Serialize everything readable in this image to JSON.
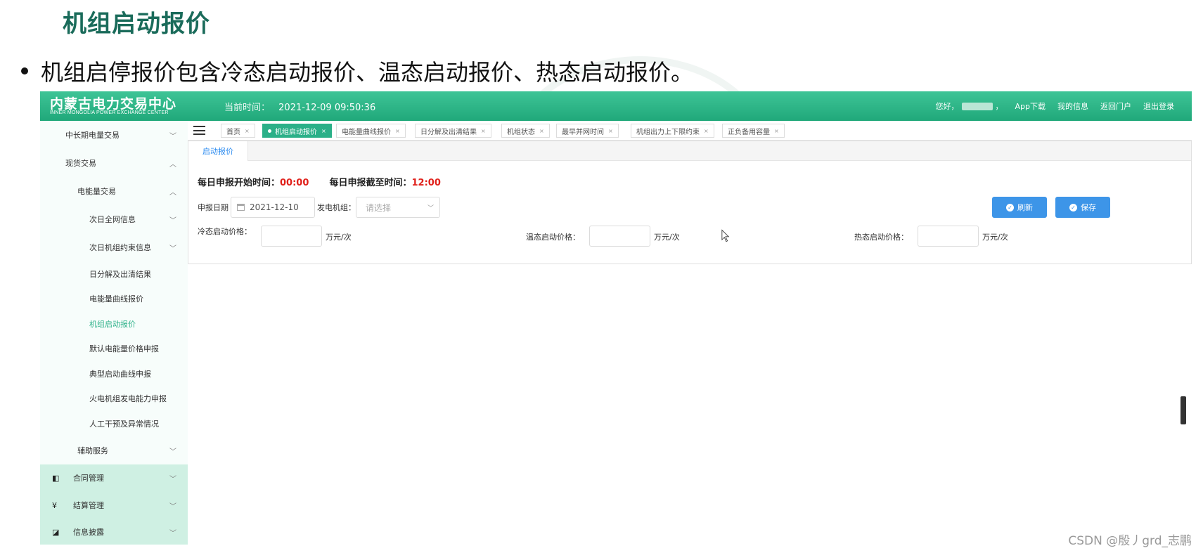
{
  "slide": {
    "title": "机组启动报价",
    "bullet": "机组启停报价包含冷态启动报价、温态启动报价、热态启动报价。"
  },
  "app": {
    "logo_cn": "内蒙古电力交易中心",
    "logo_en": "INNER MONGOLIA POWER EXCHANGE CENTER",
    "clock_label": "当前时间：",
    "clock_value": "2021-12-09 09:50:36",
    "greeting": "您好，",
    "greeting_suffix": "，",
    "top_links": [
      "App下载",
      "我的信息",
      "返回门户",
      "退出登录"
    ]
  },
  "sidebar": {
    "items": [
      {
        "label": "中长期电量交易",
        "chev": "﹀"
      },
      {
        "label": "现货交易",
        "chev": "︿"
      },
      {
        "label": "电能量交易",
        "chev": "︿"
      },
      {
        "label": "次日全网信息",
        "chev": "﹀"
      },
      {
        "label": "次日机组约束信息",
        "chev": "﹀"
      },
      {
        "label": "日分解及出清结果"
      },
      {
        "label": "电能量曲线报价"
      },
      {
        "label": "机组启动报价"
      },
      {
        "label": "默认电能量价格申报"
      },
      {
        "label": "典型启动曲线申报"
      },
      {
        "label": "火电机组发电能力申报"
      },
      {
        "label": "人工干预及异常情况"
      },
      {
        "label": "辅助服务",
        "chev": "﹀"
      },
      {
        "label": "合同管理",
        "chev": "﹀",
        "icon": "◧"
      },
      {
        "label": "结算管理",
        "chev": "﹀",
        "icon": "¥"
      },
      {
        "label": "信息披露",
        "chev": "﹀",
        "icon": "◪"
      }
    ]
  },
  "tabs": [
    {
      "label": "首页"
    },
    {
      "label": "机组启动报价"
    },
    {
      "label": "电能量曲线报价"
    },
    {
      "label": "日分解及出清结果"
    },
    {
      "label": "机组状态"
    },
    {
      "label": "最早并网时间"
    },
    {
      "label": "机组出力上下限约束"
    },
    {
      "label": "正负备用容量"
    }
  ],
  "tab_close": "×",
  "content": {
    "subtab": "启动报价",
    "start_label": "每日申报开始时间：",
    "start_time": "00:00",
    "end_label": "每日申报截至时间：",
    "end_time": "12:00",
    "date_label": "申报日期",
    "date_value": "2021-12-10",
    "unit_label": "发电机组：",
    "unit_placeholder": "请选择",
    "refresh_label": "刷新",
    "save_label": "保存",
    "cold_label": "冷态启动价格：",
    "warm_label": "温态启动价格：",
    "hot_label": "热态启动价格：",
    "price_unit": "万元/次"
  },
  "watermark": "CSDN @殷丿grd_志鹏"
}
